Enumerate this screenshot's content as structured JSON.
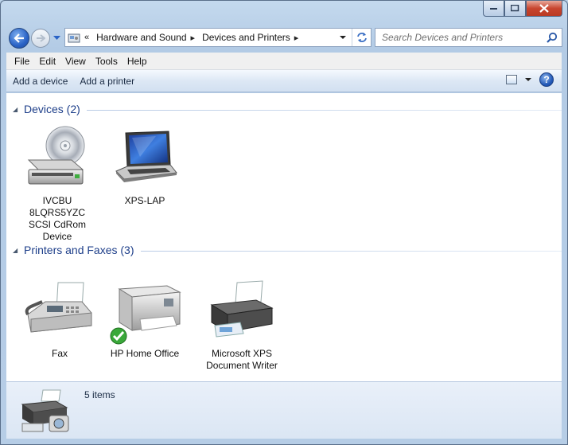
{
  "window": {
    "title": "Devices and Printers"
  },
  "address": {
    "prefix": "«",
    "crumbs": [
      "Hardware and Sound",
      "Devices and Printers"
    ],
    "separator": "▸"
  },
  "search": {
    "placeholder": "Search Devices and Printers"
  },
  "menu": {
    "file": "File",
    "edit": "Edit",
    "view": "View",
    "tools": "Tools",
    "help": "Help"
  },
  "toolbar": {
    "add_device": "Add a device",
    "add_printer": "Add a printer",
    "help": "?"
  },
  "groups": {
    "devices": {
      "title": "Devices (2)",
      "items": [
        {
          "label": "IVCBU 8LQRS5YZC SCSI CdRom Device",
          "icon": "cdrom-drive-icon"
        },
        {
          "label": "XPS-LAP",
          "icon": "laptop-icon"
        }
      ]
    },
    "printers": {
      "title": "Printers and Faxes (3)",
      "items": [
        {
          "label": "Fax",
          "icon": "fax-icon"
        },
        {
          "label": "HP Home Office",
          "icon": "printer-icon",
          "default": true
        },
        {
          "label": "Microsoft XPS Document Writer",
          "icon": "xps-printer-icon"
        }
      ]
    }
  },
  "details": {
    "count": "5 items"
  },
  "colors": {
    "accent": "#1e3f8a",
    "window_frame": "#b9cfe7",
    "close_button": "#c8452f"
  }
}
